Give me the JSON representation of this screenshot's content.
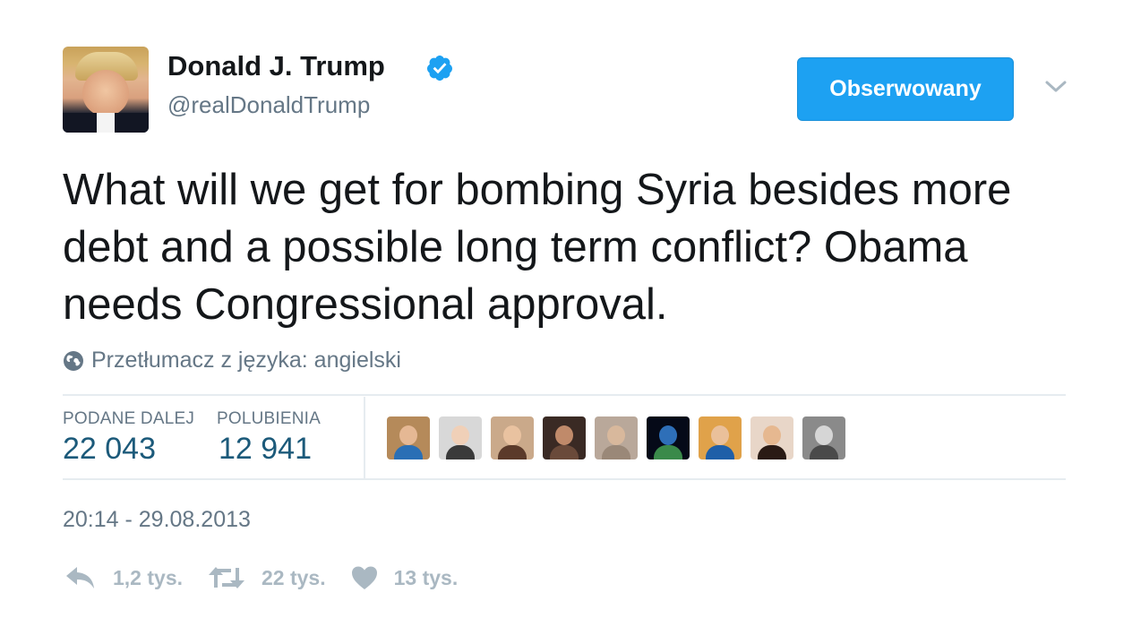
{
  "author": {
    "name": "Donald J. Trump",
    "handle": "@realDonaldTrump",
    "verified": true
  },
  "follow_button": "Obserwowany",
  "tweet_text": "What will we get for bombing Syria besides more debt and a possible long term conflict? Obama needs Congressional approval.",
  "translate_label": "Przetłumacz z języka: angielski",
  "stats": [
    {
      "label": "PODANE DALEJ",
      "value": "22 043"
    },
    {
      "label": "POLUBIENIA",
      "value": "12 941"
    }
  ],
  "likers": [
    {
      "name": "liker-1",
      "bg": "#b58a5a",
      "skin": "#e5b894",
      "cloth": "#2a6fb5"
    },
    {
      "name": "liker-2",
      "bg": "#d8d8d8",
      "skin": "#f0d0b8",
      "cloth": "#3a3a3a"
    },
    {
      "name": "liker-3",
      "bg": "#caa98a",
      "skin": "#e9c2a0",
      "cloth": "#5b3a2a"
    },
    {
      "name": "liker-4",
      "bg": "#3a2a24",
      "skin": "#c08a6a",
      "cloth": "#6a4a3a"
    },
    {
      "name": "liker-5",
      "bg": "#b9a89a",
      "skin": "#d8b89c",
      "cloth": "#9a8878"
    },
    {
      "name": "liker-6",
      "bg": "#050a18",
      "skin": "#2e6fb8",
      "cloth": "#3a8a4a"
    },
    {
      "name": "liker-7",
      "bg": "#e0a24a",
      "skin": "#eac09a",
      "cloth": "#1f5fa8"
    },
    {
      "name": "liker-8",
      "bg": "#e8d6c8",
      "skin": "#e6b890",
      "cloth": "#2a1a14"
    },
    {
      "name": "liker-9",
      "bg": "#8a8a8a",
      "skin": "#d6d6d6",
      "cloth": "#4a4a4a"
    }
  ],
  "timestamp": "20:14 - 29.08.2013",
  "actions": {
    "reply": "1,2 tys.",
    "retweet": "22 tys.",
    "like": "13 tys."
  },
  "colors": {
    "accent": "#1da1f2",
    "secondary_text": "#657786",
    "stat_value": "#1c5a7a",
    "action_icon": "#aab8c2",
    "divider": "#e6ecf0"
  }
}
